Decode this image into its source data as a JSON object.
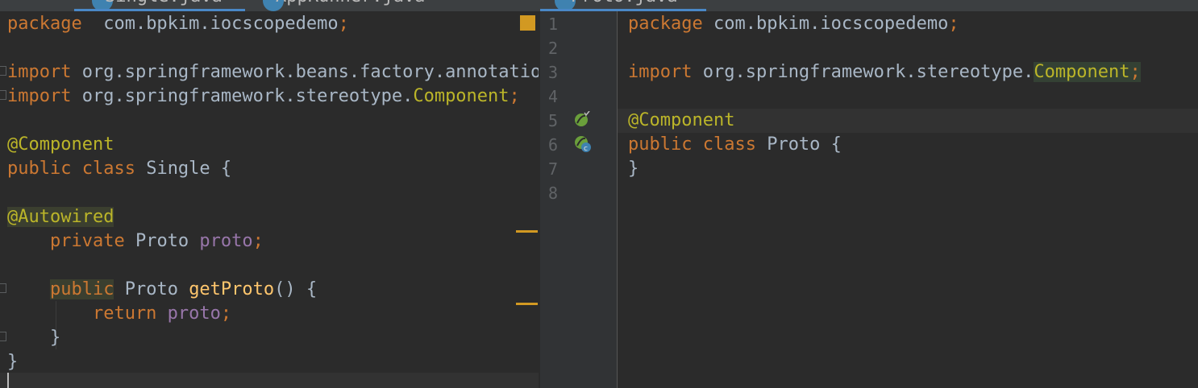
{
  "tabs": [
    {
      "label": "Single.java",
      "active": true
    },
    {
      "label": "AppRunner.java",
      "active": false
    },
    {
      "label": "",
      "active": false
    },
    {
      "label": "Proto.java",
      "active": true
    }
  ],
  "left_editor": {
    "lines": [
      {
        "segments": [
          [
            "kw",
            "package"
          ],
          [
            "",
            "  com.bpkim.iocscopedemo"
          ],
          [
            "kw",
            ";"
          ]
        ]
      },
      {
        "segments": []
      },
      {
        "segments": [
          [
            "kw",
            "import"
          ],
          [
            "",
            " org.springframework.beans.factory.annotation.Autowired;"
          ]
        ]
      },
      {
        "segments": [
          [
            "kw",
            "import"
          ],
          [
            "",
            " org.springframework.stereotype."
          ],
          [
            "ann",
            "Component"
          ],
          [
            "kw",
            ";"
          ]
        ]
      },
      {
        "segments": []
      },
      {
        "segments": [
          [
            "ann",
            "@Component"
          ]
        ]
      },
      {
        "segments": [
          [
            "kw",
            "public class"
          ],
          [
            "",
            " Single {"
          ]
        ]
      },
      {
        "segments": []
      },
      {
        "segments": [
          [
            "",
            ""
          ],
          [
            "ann hl",
            "@Autowired"
          ]
        ]
      },
      {
        "segments": [
          [
            "kw",
            "    private"
          ],
          [
            "",
            " Proto "
          ],
          [
            "fld",
            "proto"
          ],
          [
            "kw",
            ";"
          ]
        ]
      },
      {
        "segments": []
      },
      {
        "segments": [
          [
            "",
            "    "
          ],
          [
            "kw hl",
            "public"
          ],
          [
            "",
            " Proto "
          ],
          [
            "fn",
            "getProto"
          ],
          [
            "",
            "() {"
          ]
        ]
      },
      {
        "segments": [
          [
            "kw",
            "        return"
          ],
          [
            "fld",
            " proto"
          ],
          [
            "kw",
            ";"
          ]
        ]
      },
      {
        "segments": [
          [
            "",
            "    }"
          ]
        ]
      },
      {
        "segments": [
          [
            "",
            "}"
          ]
        ]
      }
    ]
  },
  "right_editor": {
    "line_numbers": [
      "1",
      "2",
      "3",
      "4",
      "5",
      "6",
      "7",
      "8"
    ],
    "lines": [
      {
        "segments": [
          [
            "kw",
            "package"
          ],
          [
            "",
            " com.bpkim.iocscopedemo"
          ],
          [
            "kw",
            ";"
          ]
        ]
      },
      {
        "segments": []
      },
      {
        "segments": [
          [
            "kw",
            "import"
          ],
          [
            "",
            " org.springframework.stereotype."
          ],
          [
            "ann hl2",
            "Component"
          ],
          [
            "kw hl2",
            ";"
          ]
        ]
      },
      {
        "segments": []
      },
      {
        "segments": [
          [
            "ann",
            "@Component"
          ]
        ]
      },
      {
        "segments": [
          [
            "kw",
            "public class"
          ],
          [
            "",
            " Proto {"
          ]
        ]
      },
      {
        "segments": [
          [
            "",
            "}"
          ]
        ]
      },
      {
        "segments": []
      }
    ],
    "gutter_icons": [
      "spring-bean-icon",
      "spring-class-icon"
    ]
  },
  "colors": {
    "background": "#2b2b2b",
    "keyword": "#cc7832",
    "annotation": "#bbb529",
    "field": "#9876aa",
    "method": "#ffc66d",
    "text": "#a9b7c6",
    "warning_marker": "#d29922"
  }
}
